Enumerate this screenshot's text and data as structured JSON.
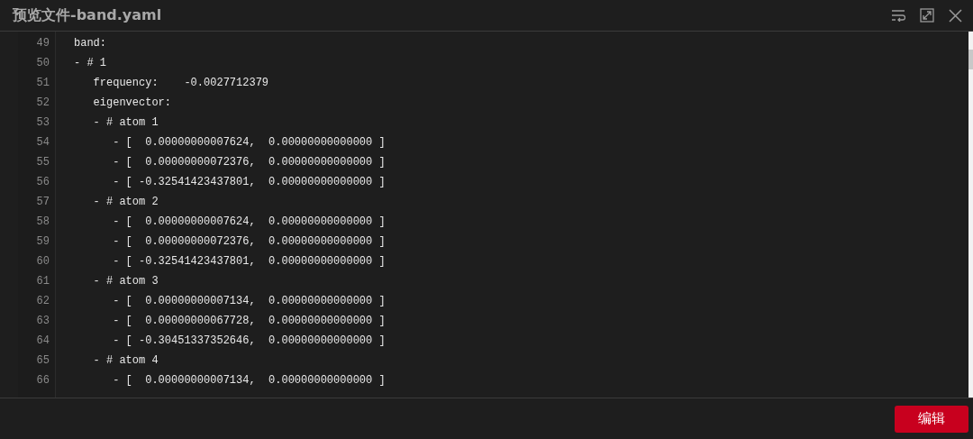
{
  "window": {
    "title": "预览文件-band.yaml"
  },
  "code_lines": [
    {
      "number": "49",
      "text": "band:"
    },
    {
      "number": "50",
      "text": "- # 1"
    },
    {
      "number": "51",
      "text": "   frequency:    -0.0027712379"
    },
    {
      "number": "52",
      "text": "   eigenvector:"
    },
    {
      "number": "53",
      "text": "   - # atom 1"
    },
    {
      "number": "54",
      "text": "      - [  0.00000000007624,  0.00000000000000 ]"
    },
    {
      "number": "55",
      "text": "      - [  0.00000000072376,  0.00000000000000 ]"
    },
    {
      "number": "56",
      "text": "      - [ -0.32541423437801,  0.00000000000000 ]"
    },
    {
      "number": "57",
      "text": "   - # atom 2"
    },
    {
      "number": "58",
      "text": "      - [  0.00000000007624,  0.00000000000000 ]"
    },
    {
      "number": "59",
      "text": "      - [  0.00000000072376,  0.00000000000000 ]"
    },
    {
      "number": "60",
      "text": "      - [ -0.32541423437801,  0.00000000000000 ]"
    },
    {
      "number": "61",
      "text": "   - # atom 3"
    },
    {
      "number": "62",
      "text": "      - [  0.00000000007134,  0.00000000000000 ]"
    },
    {
      "number": "63",
      "text": "      - [  0.00000000067728,  0.00000000000000 ]"
    },
    {
      "number": "64",
      "text": "      - [ -0.30451337352646,  0.00000000000000 ]"
    },
    {
      "number": "65",
      "text": "   - # atom 4"
    },
    {
      "number": "66",
      "text": "      - [  0.00000000007134,  0.00000000000000 ]"
    }
  ],
  "footer": {
    "buttons": [
      "编辑"
    ]
  }
}
